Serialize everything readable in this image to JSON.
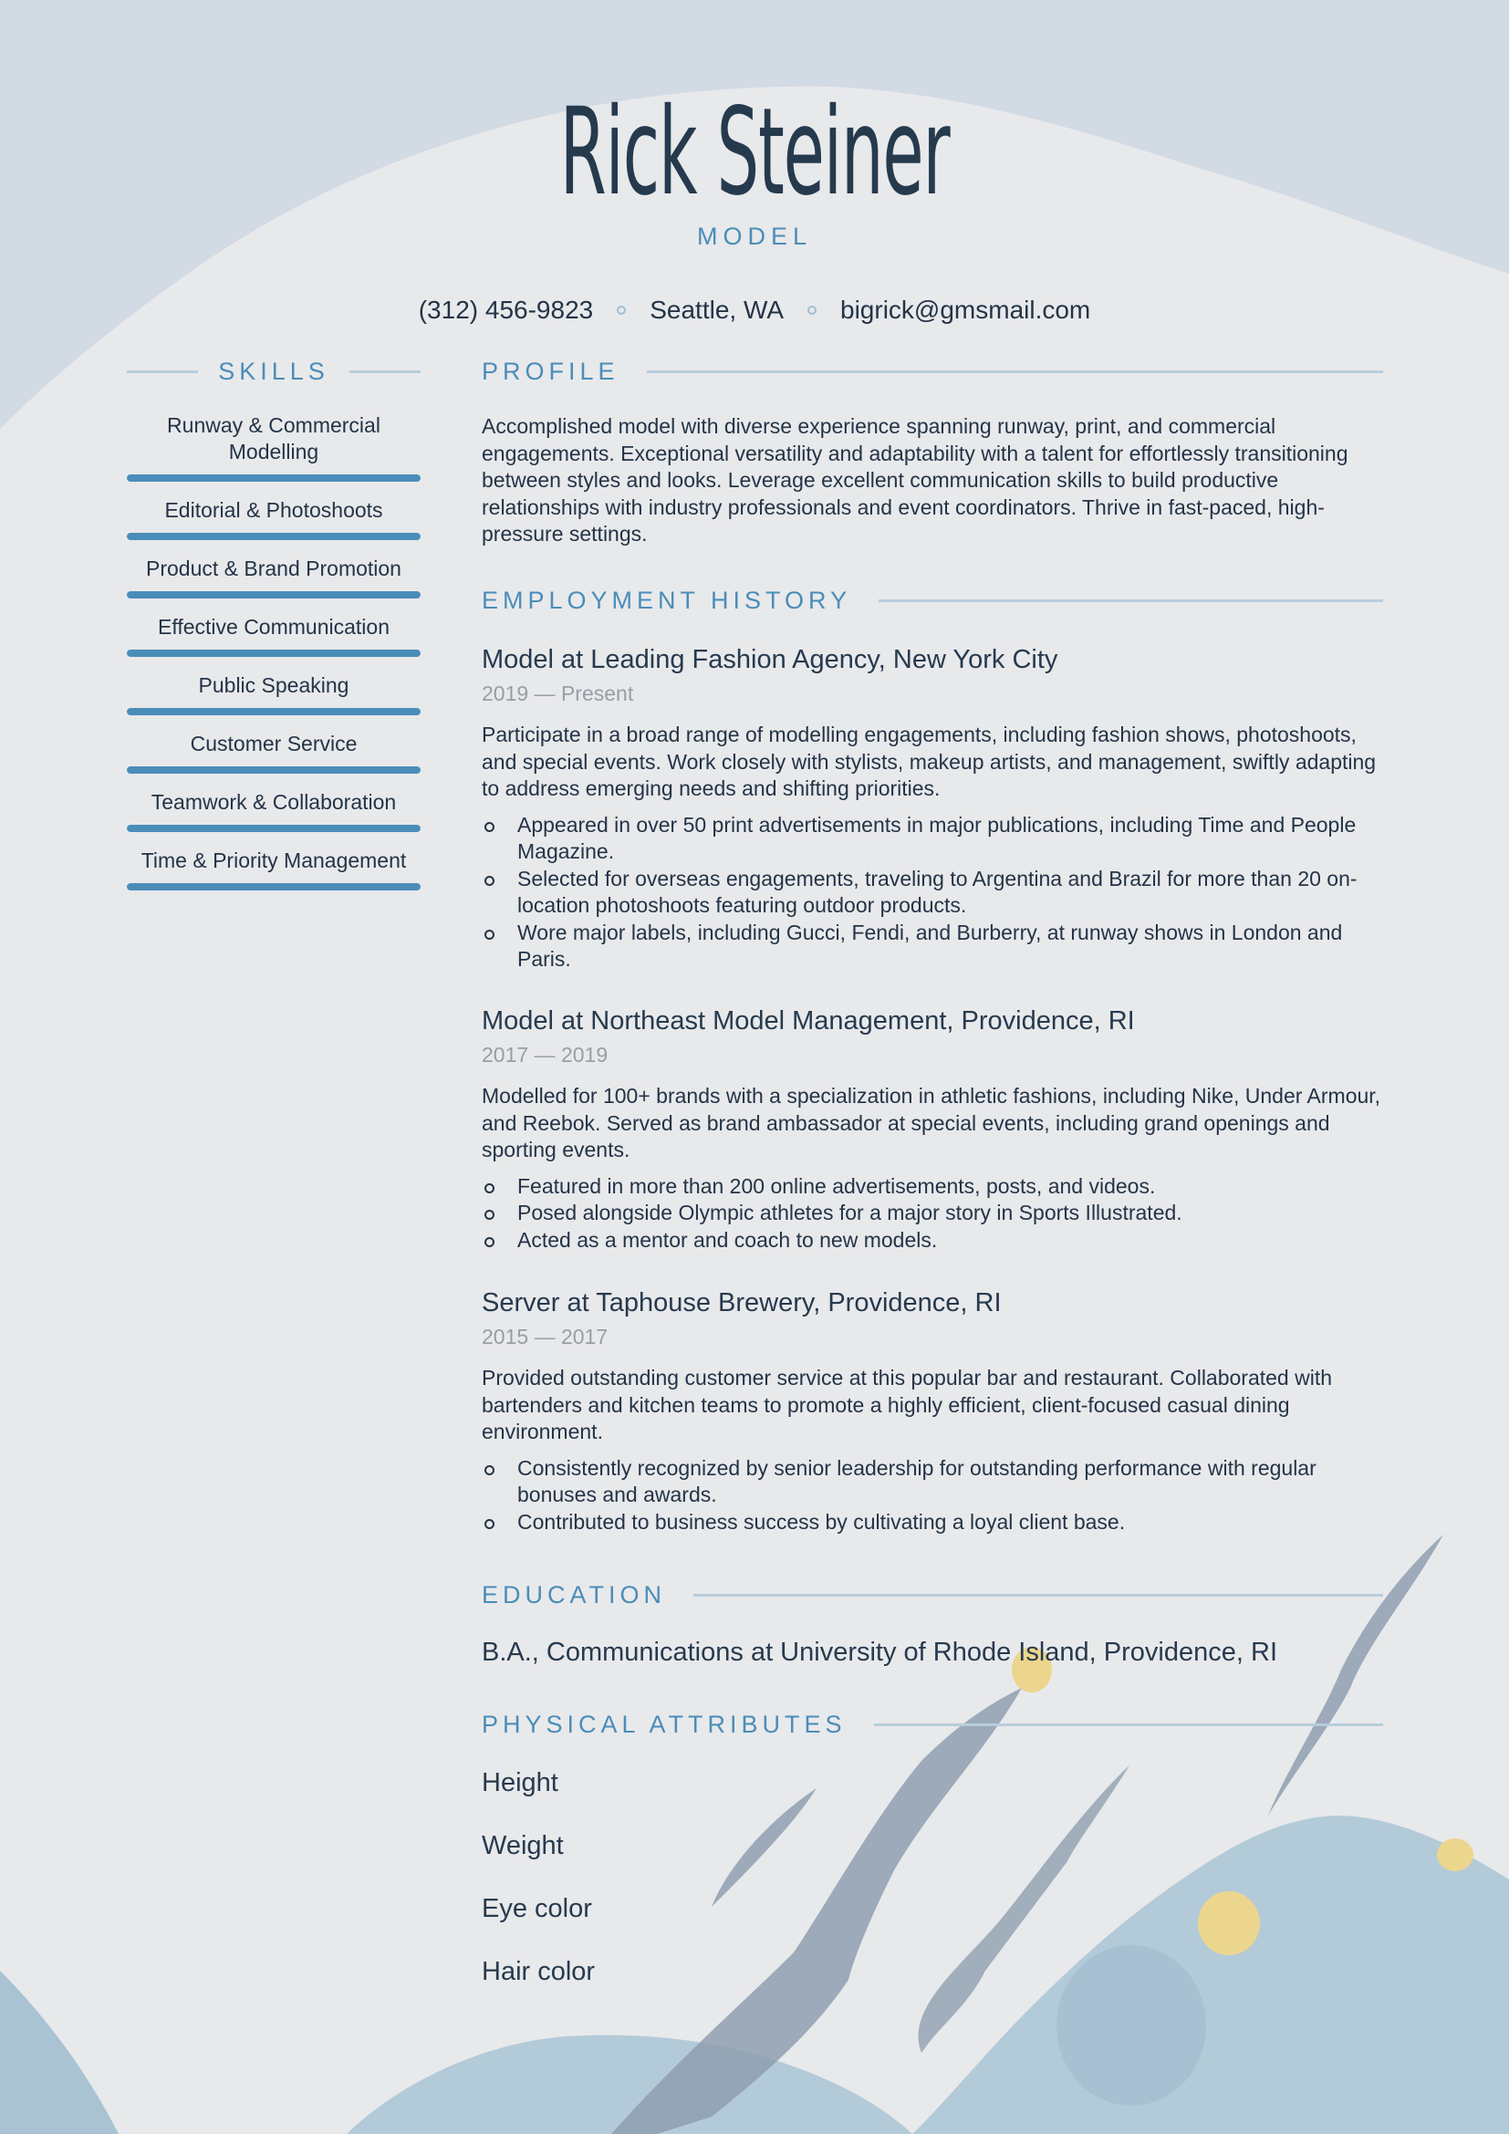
{
  "header": {
    "name": "Rick Steiner",
    "role": "MODEL",
    "contact": {
      "phone": "(312) 456-9823",
      "location": "Seattle, WA",
      "email": "bigrick@gmsmail.com"
    }
  },
  "colors": {
    "accent": "#4a8db9",
    "text": "#243447",
    "muted": "#969ea8",
    "background": "#e8e9eb"
  },
  "skills": {
    "heading": "SKILLS",
    "items": [
      {
        "label": "Runway & Commercial Modelling",
        "level": 1.0
      },
      {
        "label": "Editorial & Photoshoots",
        "level": 1.0
      },
      {
        "label": "Product & Brand Promotion",
        "level": 1.0
      },
      {
        "label": "Effective Communication",
        "level": 1.0
      },
      {
        "label": "Public Speaking",
        "level": 1.0
      },
      {
        "label": "Customer Service",
        "level": 1.0
      },
      {
        "label": "Teamwork & Collaboration",
        "level": 1.0
      },
      {
        "label": "Time & Priority Management",
        "level": 1.0
      }
    ]
  },
  "profile": {
    "heading": "PROFILE",
    "text": "Accomplished model with diverse experience spanning runway, print, and commercial engagements. Exceptional versatility and adaptability with a talent for effortlessly transitioning between styles and looks. Leverage excellent communication skills to build productive relationships with industry professionals and event coordinators. Thrive in fast-paced, high-pressure settings."
  },
  "employment": {
    "heading": "EMPLOYMENT HISTORY",
    "jobs": [
      {
        "title": "Model at Leading Fashion Agency, New York City",
        "dates": "2019 — Present",
        "summary": "Participate in a broad range of modelling engagements, including fashion shows, photoshoots, and special events. Work closely with stylists, makeup artists, and management, swiftly adapting to address emerging needs and shifting priorities.",
        "bullets": [
          "Appeared in over 50 print advertisements in major publications, including Time and People Magazine.",
          "Selected for overseas engagements, traveling to Argentina and Brazil for more than 20 on-location photoshoots featuring outdoor products.",
          "Wore major labels, including Gucci, Fendi, and Burberry, at runway shows in London and Paris."
        ]
      },
      {
        "title": "Model at Northeast Model Management, Providence, RI",
        "dates": "2017 — 2019",
        "summary": "Modelled for 100+ brands with a specialization in athletic fashions, including Nike, Under Armour, and Reebok. Served as brand ambassador at special events, including grand openings and sporting events.",
        "bullets": [
          "Featured in more than 200 online advertisements, posts, and videos.",
          "Posed alongside Olympic athletes for a major story in Sports Illustrated.",
          "Acted as a mentor and coach to new models."
        ]
      },
      {
        "title": "Server at Taphouse Brewery, Providence, RI",
        "dates": "2015 — 2017",
        "summary": "Provided outstanding customer service at this popular bar and restaurant. Collaborated with bartenders and kitchen teams to promote a highly efficient, client-focused casual dining environment.",
        "bullets": [
          "Consistently recognized by senior leadership for outstanding performance with regular bonuses and awards.",
          "Contributed to business success by cultivating a loyal client base."
        ]
      }
    ]
  },
  "education": {
    "heading": "EDUCATION",
    "items": [
      {
        "title": "B.A., Communications at University of Rhode Island, Providence, RI"
      }
    ]
  },
  "physical_attributes": {
    "heading": "PHYSICAL ATTRIBUTES",
    "items": [
      "Height",
      "Weight",
      "Eye color",
      "Hair color"
    ]
  }
}
